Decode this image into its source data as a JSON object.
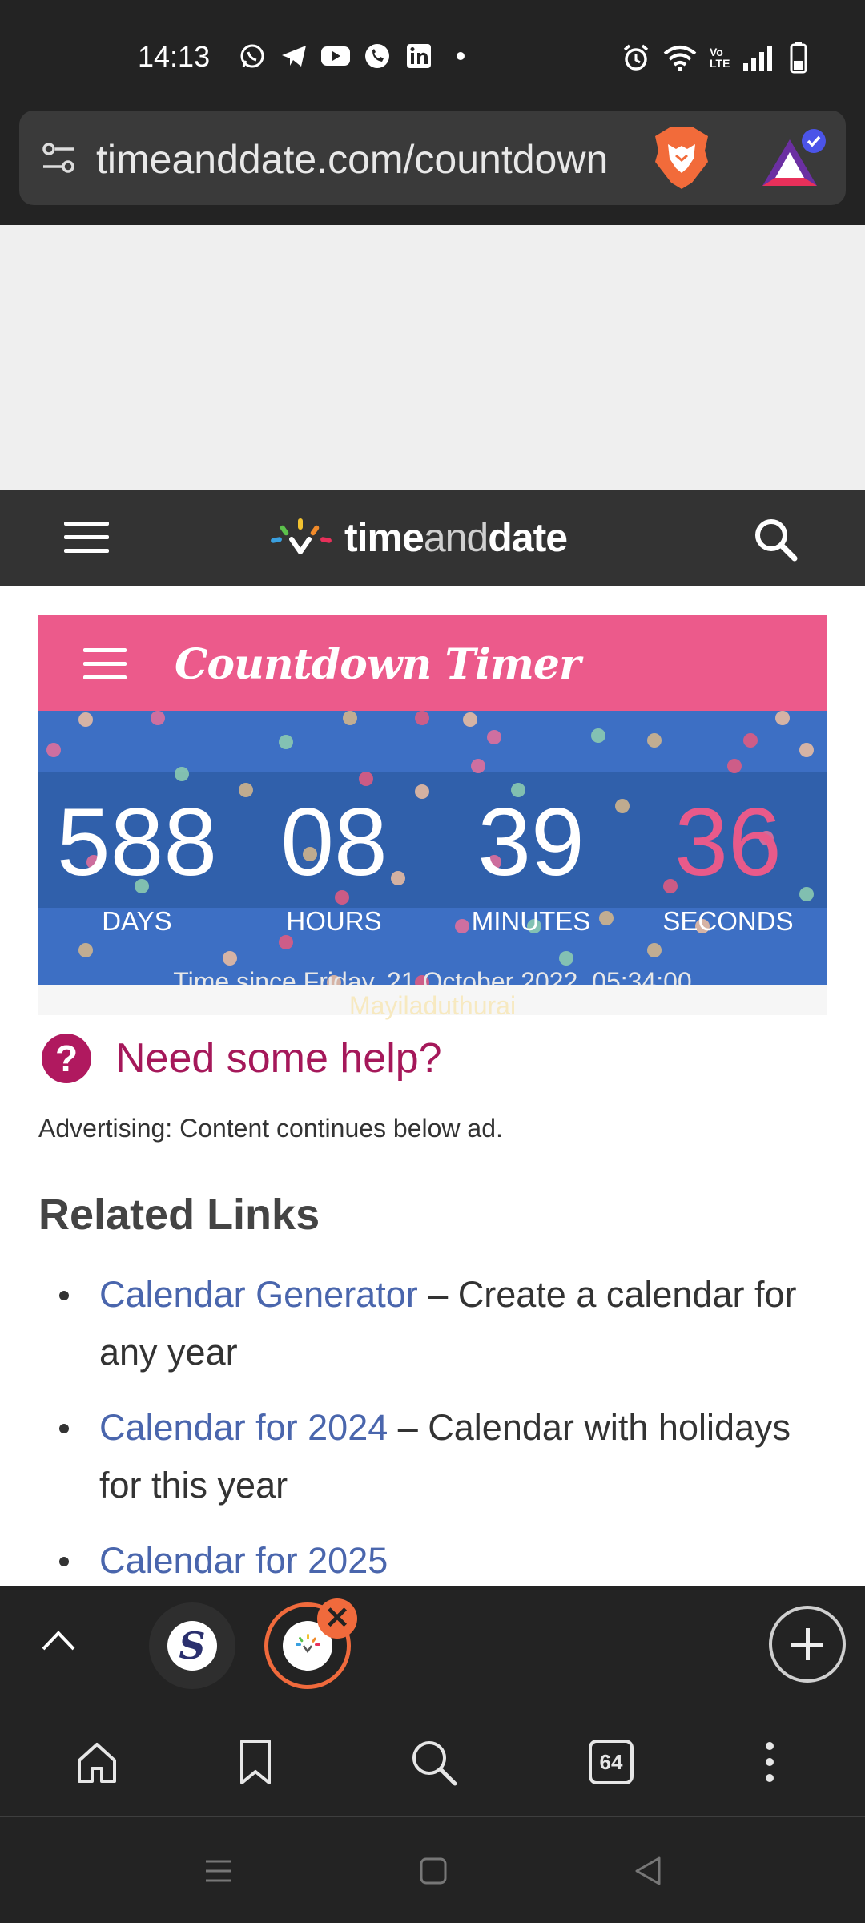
{
  "status_bar": {
    "time": "14:13",
    "left_icons": [
      "whatsapp-icon",
      "telegram-icon",
      "youtube-icon",
      "phone-app-icon",
      "linkedin-icon",
      "dot-icon"
    ],
    "right_icons": [
      "alarm-icon",
      "wifi-icon",
      "volte-icon",
      "signal-icon",
      "battery-icon"
    ],
    "volte_label": "Vo LTE"
  },
  "browser": {
    "url": "timeanddate.com/countdown"
  },
  "site_header": {
    "logo_time": "time",
    "logo_and": "and",
    "logo_date": "date"
  },
  "countdown": {
    "title": "Countdown Timer",
    "days": "588",
    "hours": "08",
    "minutes": "39",
    "seconds": "36",
    "days_label": "DAYS",
    "hours_label": "HOURS",
    "minutes_label": "MINUTES",
    "seconds_label": "SECONDS",
    "since_text": "Time since Friday, 21 October 2022, 05:34:00",
    "place": "Mayiladuthurai",
    "colors": {
      "header": "#ec5a8b",
      "body": "#3d6fc4",
      "seconds": "#e85a8a"
    }
  },
  "help": {
    "icon": "?",
    "text": "Need some help?"
  },
  "ad_note": "Advertising: Content continues below ad.",
  "related": {
    "title": "Related Links",
    "items": [
      {
        "link": "Calendar Generator",
        "desc": " – Create a calendar for any year"
      },
      {
        "link": "Calendar for 2024",
        "desc": " – Calendar with holidays for this year"
      },
      {
        "link": "Calendar for 2025",
        "desc": ""
      }
    ]
  },
  "tabs": {
    "count": "64",
    "close_glyph": "✕",
    "thumb1_letter": "S"
  },
  "toolbar": {
    "items": [
      "home-icon",
      "bookmark-icon",
      "search-icon",
      "tabs-icon",
      "more-icon"
    ]
  }
}
